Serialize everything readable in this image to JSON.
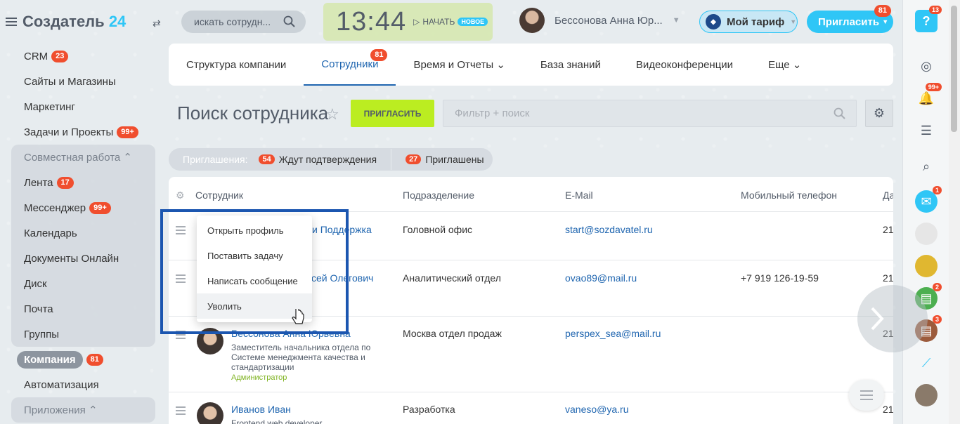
{
  "app": {
    "brand": "Создатель",
    "brand_num": "24",
    "search_placeholder": "искать сотрудн...",
    "time": "13:44",
    "start_label": "НАЧАТЬ",
    "new_label": "НОВОЕ",
    "user_name": "Бессонова Анна Юр...",
    "tariff_label": "Мой тариф",
    "invite_label": "Пригласить",
    "invite_badge": "81"
  },
  "sidebar": {
    "items": [
      {
        "label": "CRM",
        "badge": "23"
      },
      {
        "label": "Сайты и Магазины"
      },
      {
        "label": "Маркетинг"
      },
      {
        "label": "Задачи и Проекты",
        "badge": "99+"
      }
    ],
    "group1": {
      "label": "Совместная работа",
      "items": [
        {
          "label": "Лента",
          "badge": "17"
        },
        {
          "label": "Мессенджер",
          "badge": "99+"
        },
        {
          "label": "Календарь"
        },
        {
          "label": "Документы Онлайн"
        },
        {
          "label": "Диск"
        },
        {
          "label": "Почта"
        },
        {
          "label": "Группы"
        }
      ]
    },
    "company": {
      "label": "Компания",
      "badge": "81"
    },
    "automation": "Автоматизация",
    "group2": {
      "label": "Приложения"
    }
  },
  "tabs": [
    {
      "label": "Структура компании"
    },
    {
      "label": "Сотрудники",
      "badge": "81"
    },
    {
      "label": "Время и Отчеты"
    },
    {
      "label": "База знаний"
    },
    {
      "label": "Видеоконференции"
    },
    {
      "label": "Еще"
    }
  ],
  "page": {
    "title": "Поиск сотрудника",
    "invite_button": "ПРИГЛАСИТЬ",
    "filter_placeholder": "Фильтр + поиск"
  },
  "invitations": {
    "label": "Приглашения:",
    "awaiting_count": "54",
    "awaiting_label": "Ждут подтверждения",
    "invited_count": "27",
    "invited_label": "Приглашены"
  },
  "table": {
    "headers": [
      "Сотрудник",
      "Подразделение",
      "E-Mail",
      "Мобильный телефон",
      "Да"
    ],
    "rows": [
      {
        "name_tail": "и Поддержка",
        "dept": "Головной офис",
        "email": "start@sozdavatel.ru",
        "phone": "",
        "date": "21"
      },
      {
        "name_tail": "сей Олегович",
        "dept": "Аналитический отдел",
        "email": "ovao89@mail.ru",
        "phone": "+7 919 126-19-59",
        "date": "21"
      },
      {
        "name": "Бессонова Анна Юрьевна",
        "position": "Заместитель начальника отдела по Системе менеджмента качества и стандартизации",
        "role": "Администратор",
        "dept": "Москва отдел продаж",
        "email": "perspex_sea@mail.ru",
        "phone": "",
        "date": "21"
      },
      {
        "name": "Иванов Иван",
        "position": "Frontend web developer",
        "dept": "Разработка",
        "email": "vaneso@ya.ru",
        "phone": "",
        "date": "21"
      }
    ]
  },
  "context_menu": [
    "Открыть профиль",
    "Поставить задачу",
    "Написать сообщение",
    "Уволить"
  ],
  "rightbar": {
    "help_badge": "13",
    "notif_badge": "99+",
    "chat1_badge": "1",
    "chat2_badge": "2",
    "chat3_badge": "3"
  }
}
